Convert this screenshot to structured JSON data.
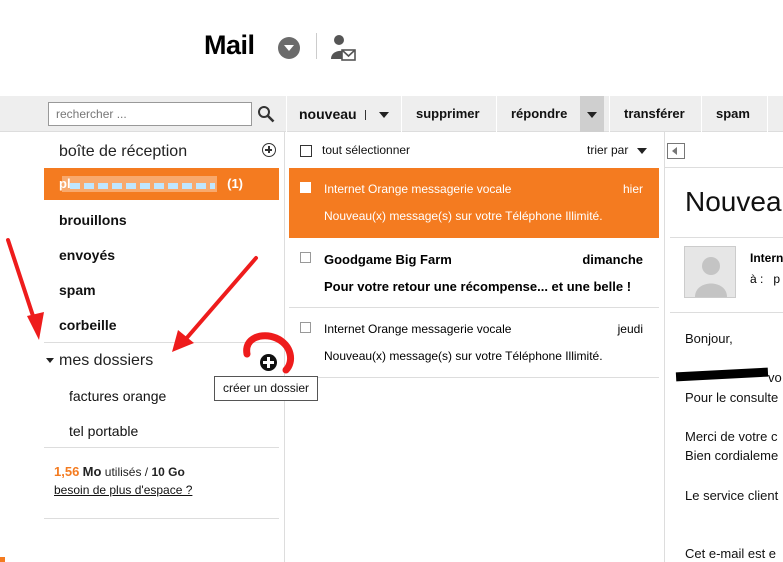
{
  "header": {
    "title": "Mail",
    "menu_icon": "chevron-down-circle-icon",
    "contacts_icon": "user-mail-icon"
  },
  "toolbar": {
    "search_placeholder": "rechercher ...",
    "new_label": "nouveau",
    "delete_label": "supprimer",
    "reply_label": "répondre",
    "forward_label": "transférer",
    "spam_label": "spam"
  },
  "sidebar": {
    "inbox_label": "boîte de réception",
    "account_label": "pl",
    "account_count": "(1)",
    "folders": [
      "brouillons",
      "envoyés",
      "spam",
      "corbeille"
    ],
    "my_folders_label": "mes dossiers",
    "subfolders": [
      "factures orange",
      "tel portable"
    ],
    "create_folder_tooltip": "créer un dossier",
    "storage": {
      "used": "1,56",
      "unit": "Mo",
      "used_label": "utilisés /",
      "total": "10 Go"
    },
    "more_space_link": "besoin de plus d'espace ?"
  },
  "message_list": {
    "select_all_label": "tout sélectionner",
    "sort_label": "trier par",
    "messages": [
      {
        "from": "Internet Orange messagerie vocale",
        "date": "hier",
        "subject": "Nouveau(x) message(s) sur votre Téléphone Illimité."
      },
      {
        "from": "Goodgame Big Farm",
        "date": "dimanche",
        "subject": "Pour votre retour une récompense... et une belle !"
      },
      {
        "from": "Internet Orange messagerie vocale",
        "date": "jeudi",
        "subject": "Nouveau(x) message(s) sur votre Téléphone Illimité."
      }
    ]
  },
  "reading_pane": {
    "title": "Nouvea",
    "from": "Intern",
    "to_label": "à :",
    "to_value": "p",
    "body": [
      "Bonjour,",
      "vo",
      "Pour le consulte",
      "Merci de votre c",
      "Bien cordialeme",
      "Le service client",
      "Cet e-mail est e"
    ]
  },
  "colors": {
    "accent": "#f47b20",
    "annotation": "#ee1c1c"
  }
}
